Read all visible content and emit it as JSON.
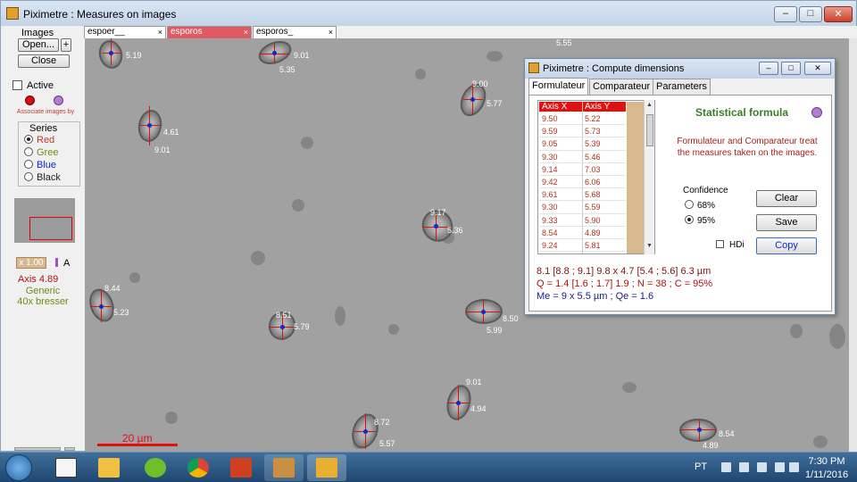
{
  "window": {
    "title": "Piximetre : Measures on images"
  },
  "left_panel": {
    "images_label": "Images",
    "open_label": "Open...",
    "plus_label": "+",
    "close_label": "Close",
    "active_label": "Active",
    "associate_label": "Associate images by color",
    "series_title": "Series",
    "series": [
      "Red",
      "Gree",
      "Blue",
      "Black"
    ],
    "series_colors": [
      "#c0392b",
      "#6b8d10",
      "#1028d0",
      "#222222"
    ],
    "zoom": "x 1.00",
    "zoom_letter": "A",
    "axis_readout": "Axis  4.89",
    "generic": "Generic",
    "lens": "40x bresser"
  },
  "tabs": [
    {
      "label": "espoer__",
      "close": "×"
    },
    {
      "label": "esporos",
      "close": "×"
    },
    {
      "label": "esporos_",
      "close": "×"
    }
  ],
  "canvas": {
    "measurements": [
      "5.55",
      "5.19",
      "9.01",
      "5.35",
      "9.00",
      "5.77",
      "4.61",
      "9.01",
      "9.17",
      "5.36",
      "8.44",
      "5.23",
      "8.51",
      "5.79",
      "8.50",
      "5.99",
      "9.01",
      "4.94",
      "8.72",
      "5.57",
      "8.54",
      "4.89"
    ],
    "scale_label": "20 µm"
  },
  "dialog": {
    "title": "Piximetre : Compute dimensions",
    "tabs": [
      "Formulateur",
      "Comparateur",
      "Parameters"
    ],
    "table_headers": [
      "Axis X",
      "Axis Y"
    ],
    "table_rows": [
      [
        "9.50",
        "5.22"
      ],
      [
        "9.59",
        "5.73"
      ],
      [
        "9.05",
        "5.39"
      ],
      [
        "9.30",
        "5.46"
      ],
      [
        "9.14",
        "7.03"
      ],
      [
        "9.42",
        "6.06"
      ],
      [
        "9.61",
        "5.68"
      ],
      [
        "9.30",
        "5.59"
      ],
      [
        "9.33",
        "5.90"
      ],
      [
        "8.54",
        "4.89"
      ],
      [
        "9.24",
        "5.81"
      ]
    ],
    "stat_title": "Statistical formula",
    "description": "Formulateur and Comparateur treat the measures taken on the images.",
    "confidence_title": "Confidence",
    "confidence_options": [
      "68%",
      "95%"
    ],
    "clear_label": "Clear",
    "save_label": "Save",
    "copy_label": "Copy",
    "hdi_label": "HDi",
    "result_line1": "8.1 [8.8 ; 9.1] 9.8 x 4.7 [5.4 ; 5.6] 6.3 µm",
    "result_line2": "Q = 1.4 [1.6 ; 1.7] 1.9 ; N = 38 ; C = 95%",
    "result_line3": "Me = 9 x 5.5 µm ; Qe = 1.6"
  },
  "taskbar": {
    "lang": "PT",
    "time": "7:30 PM",
    "date": "1/11/2016"
  },
  "colors": {
    "accent_red": "#e01010",
    "tab_active": "#e05a64",
    "table_tan": "#d8b98f",
    "stat_green": "#3a7d2a"
  }
}
